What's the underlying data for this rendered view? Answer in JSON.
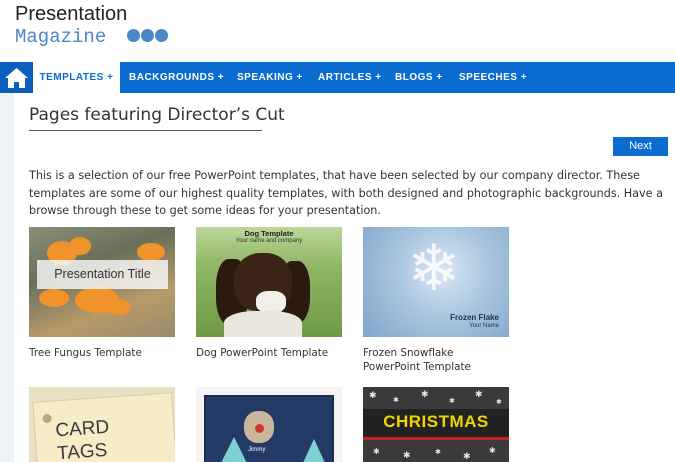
{
  "logo": {
    "line1": "Presentation",
    "line2": "Magazine"
  },
  "nav": {
    "items": [
      {
        "label": "TEMPLATES +"
      },
      {
        "label": "BACKGROUNDS +"
      },
      {
        "label": "SPEAKING +"
      },
      {
        "label": "ARTICLES +"
      },
      {
        "label": "BLOGS +"
      },
      {
        "label": "SPEECHES +"
      }
    ]
  },
  "page": {
    "title": "Pages featuring Director’s Cut",
    "next_label": "Next",
    "intro": "This is a selection of our free PowerPoint templates, that have been selected by our company director. These templates are some of our highest quality templates, with both designed and photographic backgrounds. Have a browse through these to get some ideas for your presentation."
  },
  "cards": [
    {
      "caption": "Tree Fungus Template",
      "thumb_text": "Presentation Title"
    },
    {
      "caption": "Dog PowerPoint Template",
      "thumb_text": "Dog Template",
      "thumb_sub": "Your name and company"
    },
    {
      "caption": "Frozen Snowflake PowerPoint Template",
      "thumb_text": "Frozen Flake",
      "thumb_sub": "Your Name"
    },
    {
      "thumb_text_1": "CARD",
      "thumb_text_2": "TAGS"
    },
    {
      "thumb_text": "Jimmy"
    },
    {
      "thumb_text": "CHRISTMAS"
    }
  ],
  "colors": {
    "nav_bg": "#0a6bd1",
    "logo_blue": "#4b86c6",
    "page_bg": "#eef2f7"
  },
  "icons": {
    "home": "home-icon",
    "snowflake": "snowflake-icon"
  }
}
